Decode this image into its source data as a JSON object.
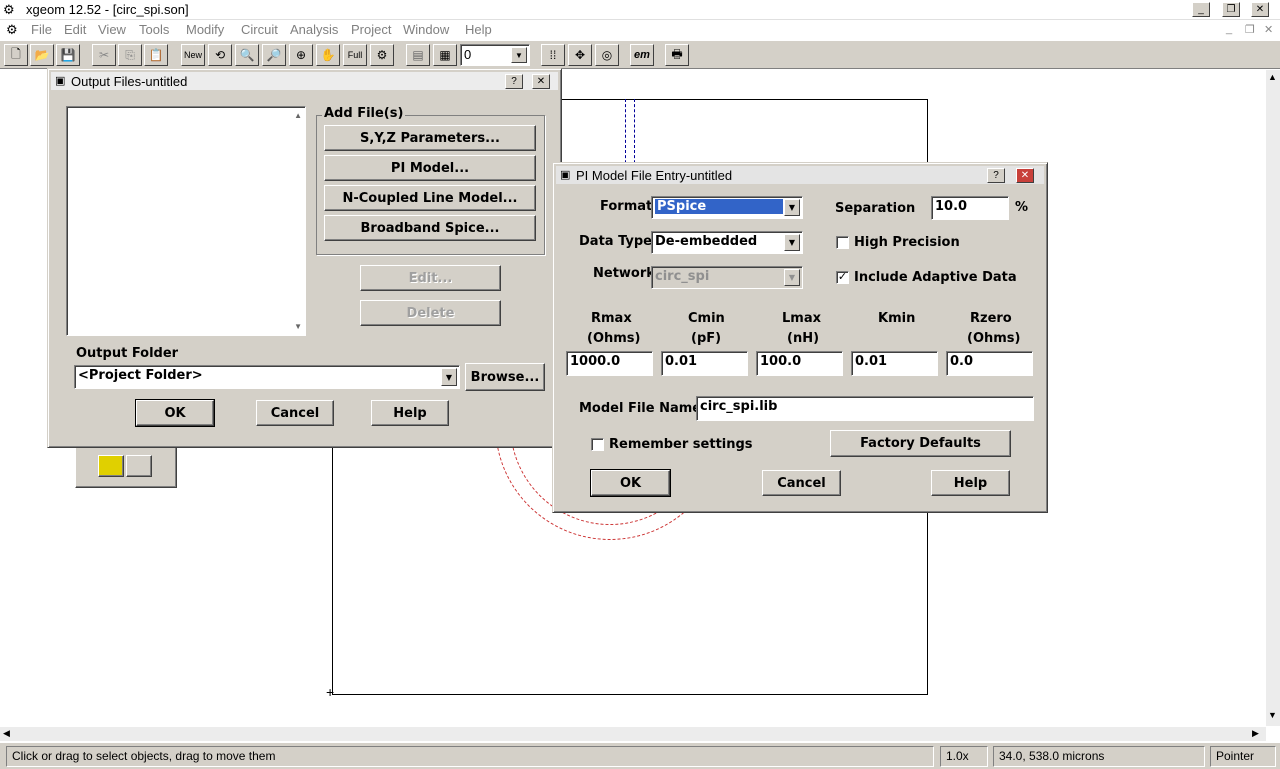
{
  "app": {
    "title": "xgeom 12.52 - [circ_spi.son]",
    "menu": [
      "File",
      "Edit",
      "View",
      "Tools",
      "Modify",
      "Circuit",
      "Analysis",
      "Project",
      "Window",
      "Help"
    ],
    "level_value": "0"
  },
  "output_files_dialog": {
    "title": "Output Files-untitled",
    "add_files_label": "Add File(s)",
    "buttons": {
      "syz": "S,Y,Z Parameters...",
      "pi_model": "PI Model...",
      "n_coupled": "N-Coupled Line Model...",
      "broadband": "Broadband Spice...",
      "edit": "Edit...",
      "delete": "Delete",
      "browse": "Browse...",
      "ok": "OK",
      "cancel": "Cancel",
      "help": "Help"
    },
    "output_folder_label": "Output Folder",
    "output_folder_value": "<Project Folder>"
  },
  "pi_dialog": {
    "title": "PI Model File Entry-untitled",
    "format_label": "Format",
    "format_value": "PSpice",
    "data_type_label": "Data Type",
    "data_type_value": "De-embedded",
    "network_label": "Network",
    "network_value": "circ_spi",
    "separation_label": "Separation",
    "separation_value": "10.0",
    "separation_unit": "%",
    "high_precision_label": "High Precision",
    "high_precision_checked": false,
    "adaptive_label": "Include Adaptive Data",
    "adaptive_checked": true,
    "params": [
      {
        "name": "Rmax",
        "unit": "(Ohms)",
        "value": "1000.0"
      },
      {
        "name": "Cmin",
        "unit": "(pF)",
        "value": "0.01"
      },
      {
        "name": "Lmax",
        "unit": "(nH)",
        "value": "100.0"
      },
      {
        "name": "Kmin",
        "unit": "",
        "value": "0.01"
      },
      {
        "name": "Rzero",
        "unit": "(Ohms)",
        "value": "0.0"
      }
    ],
    "model_file_label": "Model File Name",
    "model_file_value": "circ_spi.lib",
    "remember_label": "Remember settings",
    "factory_defaults": "Factory Defaults",
    "ok": "OK",
    "cancel": "Cancel",
    "help": "Help"
  },
  "status": {
    "message": "Click or drag to select objects, drag to move them",
    "zoom": "1.0x",
    "coords": "34.0, 538.0 microns",
    "mode": "Pointer"
  },
  "toolbar": {
    "new_label": "New",
    "full_label": "Full",
    "em_label": "em"
  }
}
